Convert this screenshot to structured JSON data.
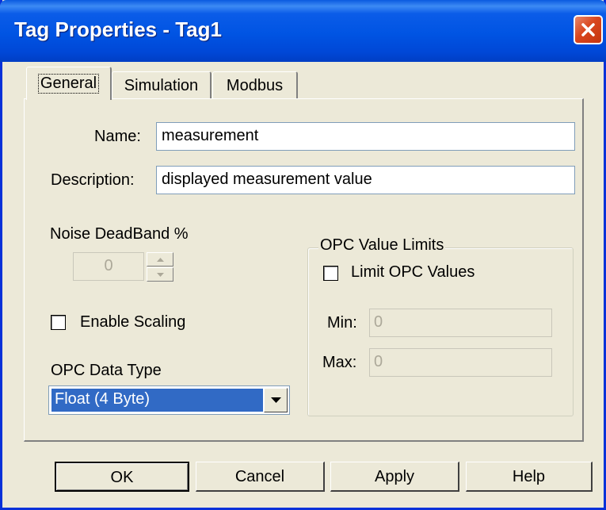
{
  "window": {
    "title": "Tag Properties - Tag1",
    "close_icon": "close-icon"
  },
  "tabs": [
    {
      "label": "General",
      "active": true
    },
    {
      "label": "Simulation",
      "active": false
    },
    {
      "label": "Modbus",
      "active": false
    }
  ],
  "general": {
    "name_label": "Name:",
    "name_value": "measurement",
    "description_label": "Description:",
    "description_value": "displayed measurement value",
    "noise_deadband_label": "Noise DeadBand %",
    "noise_deadband_value": "0",
    "enable_scaling_label": "Enable Scaling",
    "enable_scaling_checked": false,
    "opc_data_type_label": "OPC Data Type",
    "opc_data_type_value": "Float (4 Byte)",
    "opc_limits": {
      "group_title": "OPC Value Limits",
      "limit_label": "Limit OPC Values",
      "limit_checked": false,
      "min_label": "Min:",
      "min_value": "0",
      "max_label": "Max:",
      "max_value": "0"
    }
  },
  "buttons": {
    "ok": "OK",
    "cancel": "Cancel",
    "apply": "Apply",
    "help": "Help"
  },
  "colors": {
    "titlebar": "#0054e3",
    "dialog_bg": "#ece9d8",
    "selection": "#316ac5",
    "close_button": "#d9461d"
  }
}
